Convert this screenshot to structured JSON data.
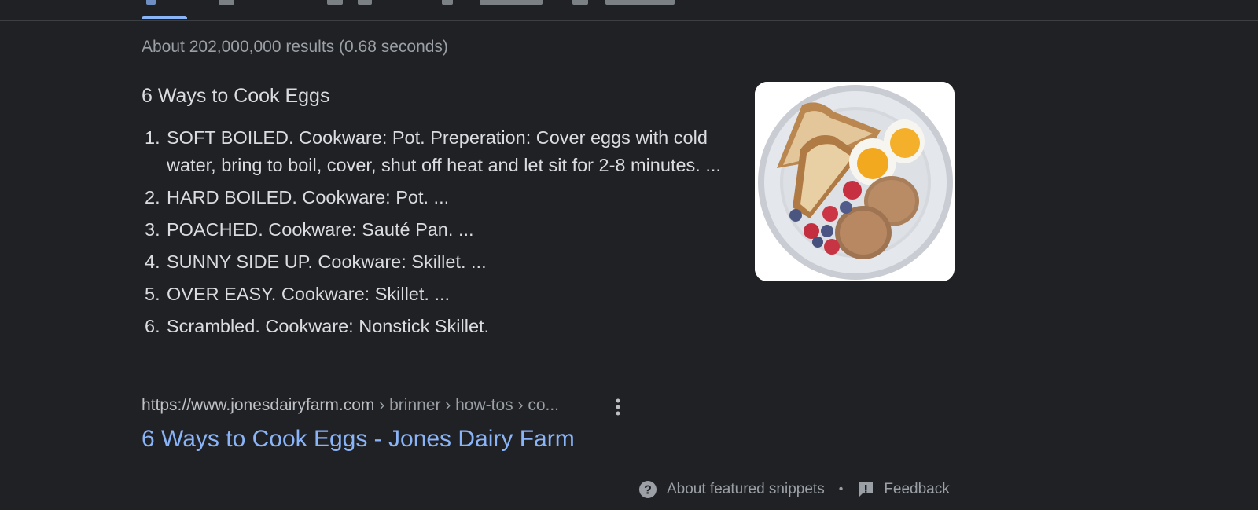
{
  "result_stats": "About 202,000,000 results (0.68 seconds)",
  "featured_snippet": {
    "heading": "6 Ways to Cook Eggs",
    "items": [
      {
        "num": "1.",
        "text": "SOFT BOILED. Cookware: Pot. Preperation: Cover eggs with cold water, bring to boil, cover, shut off heat and let sit for 2-8 minutes. ..."
      },
      {
        "num": "2.",
        "text": "HARD BOILED. Cookware: Pot. ..."
      },
      {
        "num": "3.",
        "text": "POACHED. Cookware: Sauté Pan. ..."
      },
      {
        "num": "4.",
        "text": "SUNNY SIDE UP. Cookware: Skillet. ..."
      },
      {
        "num": "5.",
        "text": "OVER EASY. Cookware: Skillet. ..."
      },
      {
        "num": "6.",
        "text": "Scrambled. Cookware: Nonstick Skillet."
      }
    ],
    "image_icon": "breakfast-plate-image",
    "source": {
      "url": "https://www.jonesdairyfarm.com",
      "breadcrumbs": " › brinner › how-tos › co...",
      "title": "6 Ways to Cook Eggs - Jones Dairy Farm"
    }
  },
  "footer": {
    "about_label": "About featured snippets",
    "separator": "•",
    "feedback_label": "Feedback"
  },
  "colors": {
    "background": "#202124",
    "link": "#8ab4f8",
    "text": "#dadce0",
    "muted": "#9aa0a6"
  }
}
